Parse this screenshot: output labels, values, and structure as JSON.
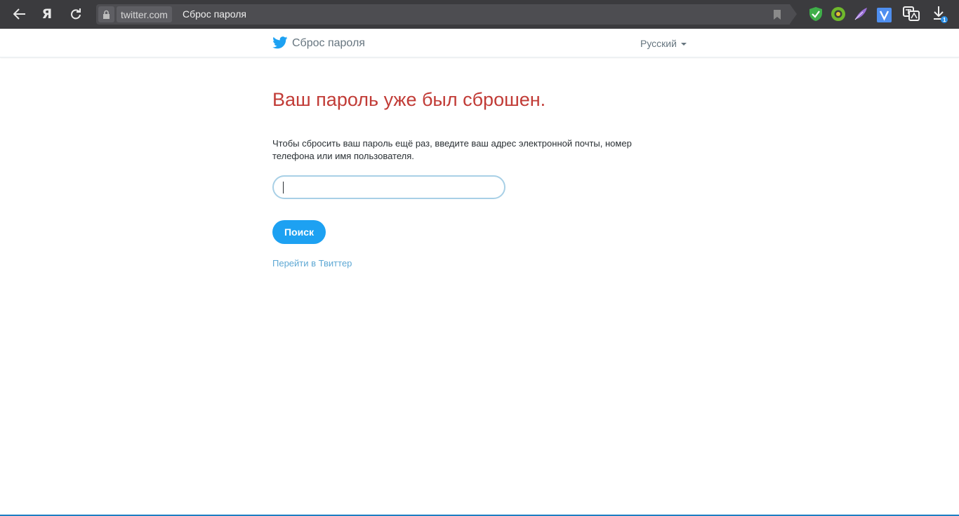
{
  "browser": {
    "browser_logo_letter": "Я",
    "domain": "twitter.com",
    "tab_title": "Сброс пароля",
    "download_badge": "1",
    "colors": {
      "chrome_bg": "#3b3b3e",
      "address_bg": "#4d4d51"
    },
    "extensions": [
      "shield-check-icon",
      "green-circle-extension-icon",
      "feather-extension-icon",
      "v-extension-icon",
      "translate-icon",
      "download-icon"
    ]
  },
  "header": {
    "title": "Сброс пароля",
    "language": "Русский"
  },
  "main": {
    "heading": "Ваш пароль уже был сброшен.",
    "instructions": "Чтобы сбросить ваш пароль ещё раз, введите ваш адрес электронной почты, номер телефона или имя пользователя.",
    "input_value": "",
    "search_label": "Поиск",
    "goto_link": "Перейти в Твиттер"
  },
  "colors": {
    "heading": "#c13b36",
    "button": "#1da1f2",
    "link": "#5ea8d4",
    "twitter_blue": "#1da1f2"
  }
}
